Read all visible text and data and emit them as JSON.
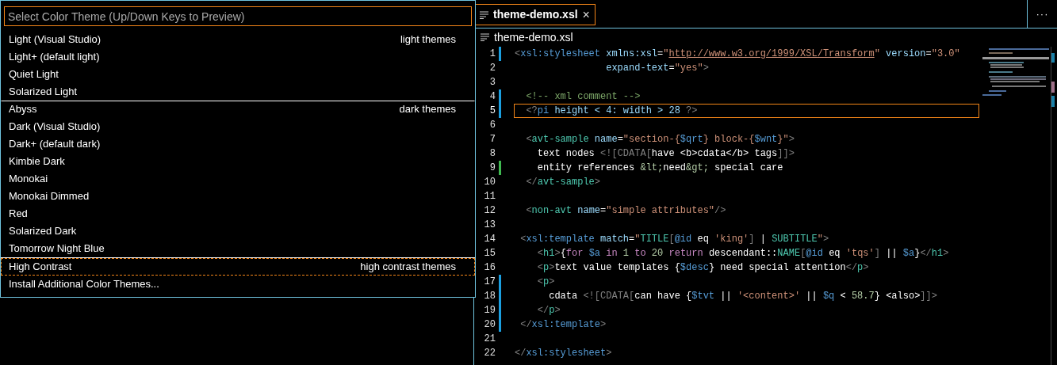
{
  "quick_pick": {
    "placeholder": "Select Color Theme (Up/Down Keys to Preview)",
    "items": [
      {
        "label": "Light (Visual Studio)",
        "category": "light themes",
        "selected": false
      },
      {
        "label": "Light+ (default light)",
        "selected": false
      },
      {
        "label": "Quiet Light",
        "selected": false
      },
      {
        "label": "Solarized Light",
        "selected": false
      },
      {
        "label": "Abyss",
        "category": "dark themes",
        "selected": false
      },
      {
        "label": "Dark (Visual Studio)",
        "selected": false
      },
      {
        "label": "Dark+ (default dark)",
        "selected": false
      },
      {
        "label": "Kimbie Dark",
        "selected": false
      },
      {
        "label": "Monokai",
        "selected": false
      },
      {
        "label": "Monokai Dimmed",
        "selected": false
      },
      {
        "label": "Red",
        "selected": false
      },
      {
        "label": "Solarized Dark",
        "selected": false
      },
      {
        "label": "Tomorrow Night Blue",
        "selected": false
      },
      {
        "label": "High Contrast",
        "category": "high contrast themes",
        "selected": true
      },
      {
        "label": "Install Additional Color Themes...",
        "selected": false
      }
    ]
  },
  "tabs": [
    {
      "label": "theme-demo.xsl",
      "close": "×",
      "selected": true
    }
  ],
  "more_actions": "···",
  "breadcrumb": "theme-demo.xsl",
  "lines": [
    {
      "number": "1",
      "modified": true,
      "added": false,
      "current": false,
      "tokens": [
        {
          "kind": "bracket",
          "text": "<"
        },
        {
          "kind": "xsltag",
          "text": "xsl:stylesheet"
        },
        {
          "kind": "attr",
          "text": " xmlns:xsl"
        },
        {
          "kind": "eq",
          "text": "="
        },
        {
          "kind": "string",
          "text": "\""
        },
        {
          "kind": "url",
          "text": "http://www.w3.org/1999/XSL/Transform"
        },
        {
          "kind": "string",
          "text": "\""
        },
        {
          "kind": "attr",
          "text": " version"
        },
        {
          "kind": "eq",
          "text": "="
        },
        {
          "kind": "string",
          "text": "\"3.0\""
        }
      ]
    },
    {
      "number": "2",
      "modified": false,
      "added": false,
      "current": false,
      "tokens": [
        {
          "kind": "attr",
          "text": "                expand-text"
        },
        {
          "kind": "eq",
          "text": "="
        },
        {
          "kind": "string",
          "text": "\"yes\""
        },
        {
          "kind": "bracket",
          "text": ">"
        }
      ]
    },
    {
      "number": "3",
      "modified": false,
      "added": false,
      "current": false
    },
    {
      "number": "4",
      "modified": true,
      "added": false,
      "current": false,
      "tokens": [
        {
          "kind": "comment",
          "text": "  <!-- xml comment -->"
        }
      ]
    },
    {
      "number": "5",
      "modified": true,
      "added": false,
      "current": true,
      "tokens": [
        {
          "kind": "bracket",
          "text": "  <?"
        },
        {
          "kind": "xsltag",
          "text": "pi"
        },
        {
          "kind": "attr",
          "text": " height < 4: width > 28"
        },
        {
          "kind": "bracket",
          "text": " ?>"
        }
      ]
    },
    {
      "number": "6",
      "modified": false,
      "added": false,
      "current": false
    },
    {
      "number": "7",
      "modified": false,
      "added": false,
      "current": false,
      "tokens": [
        {
          "kind": "bracket",
          "text": "  <"
        },
        {
          "kind": "tag",
          "text": "avt-sample"
        },
        {
          "kind": "attr",
          "text": " name"
        },
        {
          "kind": "eq",
          "text": "="
        },
        {
          "kind": "string",
          "text": "\"section-{"
        },
        {
          "kind": "variable",
          "text": "$qrt"
        },
        {
          "kind": "string",
          "text": "} block-{"
        },
        {
          "kind": "variable",
          "text": "$wnt"
        },
        {
          "kind": "string",
          "text": "}\""
        },
        {
          "kind": "bracket",
          "text": ">"
        }
      ]
    },
    {
      "number": "8",
      "modified": false,
      "added": false,
      "current": false,
      "tokens": [
        {
          "kind": "text",
          "text": "    text nodes "
        },
        {
          "kind": "cdata",
          "text": "<![CDATA["
        },
        {
          "kind": "text",
          "text": "have <b>cdata</b> tags"
        },
        {
          "kind": "cdata",
          "text": "]]>"
        }
      ]
    },
    {
      "number": "9",
      "modified": false,
      "added": true,
      "current": false,
      "tokens": [
        {
          "kind": "text",
          "text": "    entity references "
        },
        {
          "kind": "entity",
          "text": "&lt;"
        },
        {
          "kind": "text",
          "text": "need"
        },
        {
          "kind": "entity",
          "text": "&gt;"
        },
        {
          "kind": "text",
          "text": " special care"
        }
      ]
    },
    {
      "number": "10",
      "modified": false,
      "added": false,
      "current": false,
      "tokens": [
        {
          "kind": "bracket",
          "text": "  </"
        },
        {
          "kind": "tag",
          "text": "avt-sample"
        },
        {
          "kind": "bracket",
          "text": ">"
        }
      ]
    },
    {
      "number": "11",
      "modified": false,
      "added": false,
      "current": false
    },
    {
      "number": "12",
      "modified": false,
      "added": false,
      "current": false,
      "tokens": [
        {
          "kind": "bracket",
          "text": "  <"
        },
        {
          "kind": "tag",
          "text": "non-avt"
        },
        {
          "kind": "attr",
          "text": " name"
        },
        {
          "kind": "eq",
          "text": "="
        },
        {
          "kind": "string",
          "text": "\"simple attributes\""
        },
        {
          "kind": "bracket",
          "text": "/>"
        }
      ]
    },
    {
      "number": "13",
      "modified": false,
      "added": false,
      "current": false
    },
    {
      "number": "14",
      "modified": false,
      "added": false,
      "current": false,
      "tokens": [
        {
          "kind": "bracket",
          "text": " <"
        },
        {
          "kind": "xsltag",
          "text": "xsl:template"
        },
        {
          "kind": "attr",
          "text": " match"
        },
        {
          "kind": "eq",
          "text": "="
        },
        {
          "kind": "string",
          "text": "\""
        },
        {
          "kind": "name",
          "text": "TITLE"
        },
        {
          "kind": "bracket",
          "text": "["
        },
        {
          "kind": "axis",
          "text": "@id"
        },
        {
          "kind": "text",
          "text": " eq "
        },
        {
          "kind": "string",
          "text": "'king'"
        },
        {
          "kind": "bracket",
          "text": "]"
        },
        {
          "kind": "text",
          "text": " | "
        },
        {
          "kind": "name",
          "text": "SUBTITLE"
        },
        {
          "kind": "string",
          "text": "\""
        },
        {
          "kind": "bracket",
          "text": ">"
        }
      ]
    },
    {
      "number": "15",
      "modified": false,
      "added": false,
      "current": false,
      "tokens": [
        {
          "kind": "bracket",
          "text": "    <"
        },
        {
          "kind": "tag",
          "text": "h1"
        },
        {
          "kind": "bracket",
          "text": ">"
        },
        {
          "kind": "text",
          "text": "{"
        },
        {
          "kind": "keyword",
          "text": "for"
        },
        {
          "kind": "variable",
          "text": " $a"
        },
        {
          "kind": "keyword",
          "text": " in"
        },
        {
          "kind": "number",
          "text": " 1"
        },
        {
          "kind": "keyword",
          "text": " to"
        },
        {
          "kind": "number",
          "text": " 20"
        },
        {
          "kind": "keyword",
          "text": " return"
        },
        {
          "kind": "text",
          "text": " descendant::"
        },
        {
          "kind": "name",
          "text": "NAME"
        },
        {
          "kind": "bracket",
          "text": "["
        },
        {
          "kind": "axis",
          "text": "@id"
        },
        {
          "kind": "text",
          "text": " eq "
        },
        {
          "kind": "string",
          "text": "'tqs'"
        },
        {
          "kind": "bracket",
          "text": "]"
        },
        {
          "kind": "text",
          "text": " || "
        },
        {
          "kind": "variable",
          "text": "$a"
        },
        {
          "kind": "text",
          "text": "}"
        },
        {
          "kind": "bracket",
          "text": "</"
        },
        {
          "kind": "tag",
          "text": "h1"
        },
        {
          "kind": "bracket",
          "text": ">"
        }
      ]
    },
    {
      "number": "16",
      "modified": false,
      "added": false,
      "current": false,
      "tokens": [
        {
          "kind": "bracket",
          "text": "    <"
        },
        {
          "kind": "tag",
          "text": "p"
        },
        {
          "kind": "bracket",
          "text": ">"
        },
        {
          "kind": "text",
          "text": "text value templates {"
        },
        {
          "kind": "variable",
          "text": "$desc"
        },
        {
          "kind": "text",
          "text": "} need special attention"
        },
        {
          "kind": "bracket",
          "text": "</"
        },
        {
          "kind": "tag",
          "text": "p"
        },
        {
          "kind": "bracket",
          "text": ">"
        }
      ]
    },
    {
      "number": "17",
      "modified": true,
      "added": false,
      "current": false,
      "tokens": [
        {
          "kind": "bracket",
          "text": "    <"
        },
        {
          "kind": "tag",
          "text": "p"
        },
        {
          "kind": "bracket",
          "text": ">"
        }
      ]
    },
    {
      "number": "18",
      "modified": true,
      "added": false,
      "current": false,
      "tokens": [
        {
          "kind": "text",
          "text": "      cdata "
        },
        {
          "kind": "cdata",
          "text": "<![CDATA["
        },
        {
          "kind": "text",
          "text": "can have {"
        },
        {
          "kind": "variable",
          "text": "$tvt"
        },
        {
          "kind": "text",
          "text": " || "
        },
        {
          "kind": "string",
          "text": "'<content>'"
        },
        {
          "kind": "text",
          "text": " || "
        },
        {
          "kind": "variable",
          "text": "$q"
        },
        {
          "kind": "text",
          "text": " < "
        },
        {
          "kind": "number",
          "text": "58.7"
        },
        {
          "kind": "text",
          "text": "} <also>"
        },
        {
          "kind": "cdata",
          "text": "]]>"
        }
      ]
    },
    {
      "number": "19",
      "modified": true,
      "added": false,
      "current": false,
      "tokens": [
        {
          "kind": "bracket",
          "text": "    </"
        },
        {
          "kind": "tag",
          "text": "p"
        },
        {
          "kind": "bracket",
          "text": ">"
        }
      ]
    },
    {
      "number": "20",
      "modified": true,
      "added": false,
      "current": false,
      "tokens": [
        {
          "kind": "bracket",
          "text": " </"
        },
        {
          "kind": "xsltag",
          "text": "xsl:template"
        },
        {
          "kind": "bracket",
          "text": ">"
        }
      ]
    },
    {
      "number": "21",
      "modified": false,
      "added": false,
      "current": false
    },
    {
      "number": "22",
      "modified": false,
      "added": false,
      "current": false,
      "tokens": [
        {
          "kind": "bracket",
          "text": "</"
        },
        {
          "kind": "xsltag",
          "text": "xsl:stylesheet"
        },
        {
          "kind": "bracket",
          "text": ">"
        }
      ]
    }
  ]
}
